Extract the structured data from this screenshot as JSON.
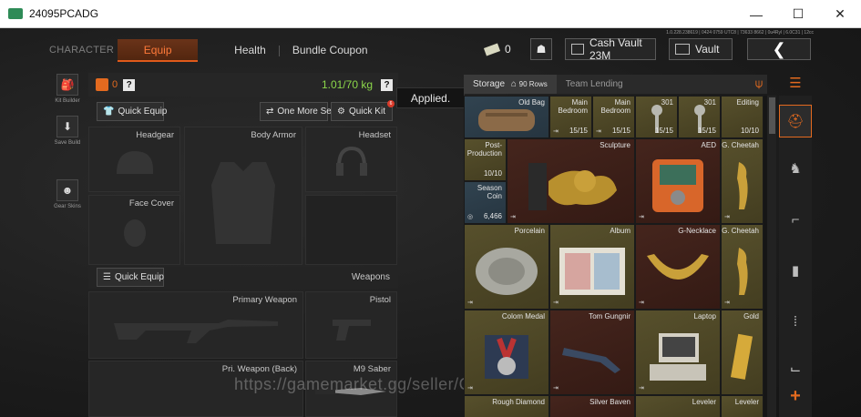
{
  "window": {
    "title": "24095PCADG",
    "minimize": "—",
    "maximize": "☐",
    "close": "✕"
  },
  "debug": "1.0.228.238619 | 0424 0759 UTC8 | 73633 8662 | 0u4Ryl | 6.0C31 | 12cc",
  "nav": {
    "character": "CHARACTER",
    "equip": "Equip",
    "health": "Health",
    "bundle": "Bundle Coupon"
  },
  "top_right": {
    "cash_count": "0",
    "cash_vault": "Cash Vault 23M",
    "vault": "Vault",
    "back": "❮"
  },
  "tools": [
    {
      "label": "Kit Builder",
      "glyph": "🎒"
    },
    {
      "label": "Save Build",
      "glyph": "⬇"
    },
    {
      "label": "Gear Skins",
      "glyph": "☻"
    }
  ],
  "equip": {
    "bag_count": "0",
    "help": "?",
    "weight": "1.01/70 kg",
    "quick_equip": "Quick Equip",
    "one_more_set": "One More Set",
    "quick_kit": "Quick Kit",
    "quick_kit_badge": "6",
    "tooltip": "Applied.",
    "slots": {
      "headgear": "Headgear",
      "body_armor": "Body Armor",
      "headset": "Headset",
      "face_cover": "Face Cover"
    },
    "weapons_quick_equip": "Quick Equip",
    "weapons_label": "Weapons",
    "weapon_slots": {
      "primary": "Primary Weapon",
      "pistol": "Pistol",
      "pri_back": "Pri. Weapon (Back)",
      "melee": "M9 Saber"
    }
  },
  "watermark": "https://gamemarket.gg/seller/GameNews",
  "storage": {
    "tab_storage": "Storage",
    "rows": "90 Rows",
    "tab_team": "Team Lending",
    "items": [
      {
        "name": "Old Bag",
        "count": "",
        "tint": "blue"
      },
      {
        "name": "Main\nBedroom",
        "count": "15/15",
        "tint": "gold"
      },
      {
        "name": "Main\nBedroom",
        "count": "15/15",
        "tint": "gold"
      },
      {
        "name": "301",
        "count": "15/15",
        "tint": "gold"
      },
      {
        "name": "301",
        "count": "15/15",
        "tint": "gold"
      },
      {
        "name": "Editing",
        "count": "10/10",
        "tint": "gold"
      },
      {
        "name": "Post-\nProduction",
        "count": "10/10",
        "tint": "gold"
      },
      {
        "name": "Season\nCoin",
        "count": "6,466",
        "tint": "blue"
      },
      {
        "name": "Sculpture",
        "count": "",
        "tint": "red"
      },
      {
        "name": "AED",
        "count": "",
        "tint": "red"
      },
      {
        "name": "G. Cheetah",
        "count": "",
        "tint": "gold"
      },
      {
        "name": "Porcelain",
        "count": "",
        "tint": "gold"
      },
      {
        "name": "Album",
        "count": "",
        "tint": "gold"
      },
      {
        "name": "G-Necklace",
        "count": "",
        "tint": "red"
      },
      {
        "name": "G. Cheetah",
        "count": "",
        "tint": "gold"
      },
      {
        "name": "Colom Medal",
        "count": "",
        "tint": "gold"
      },
      {
        "name": "Tom Gungnir",
        "count": "",
        "tint": "red"
      },
      {
        "name": "Laptop",
        "count": "",
        "tint": "gold"
      },
      {
        "name": "Gold",
        "count": "",
        "tint": "gold"
      },
      {
        "name": "Rough Diamond",
        "count": "",
        "tint": "gold"
      },
      {
        "name": "Silver Baven",
        "count": "",
        "tint": "red"
      },
      {
        "name": "Leveler",
        "count": "",
        "tint": "gold"
      },
      {
        "name": "Leveler",
        "count": "",
        "tint": "gold"
      }
    ]
  },
  "categories": [
    "helmet-icon",
    "armor-icon",
    "boar-icon",
    "rifle-icon",
    "magazine-icon",
    "ammo-icon",
    "boot-icon",
    "add-icon"
  ],
  "colors": {
    "accent": "#e36a1f",
    "weight_ok": "#8bd64a",
    "gold_tint": "#57502c",
    "red_tint": "#45251d",
    "blue_tint": "#314350"
  }
}
